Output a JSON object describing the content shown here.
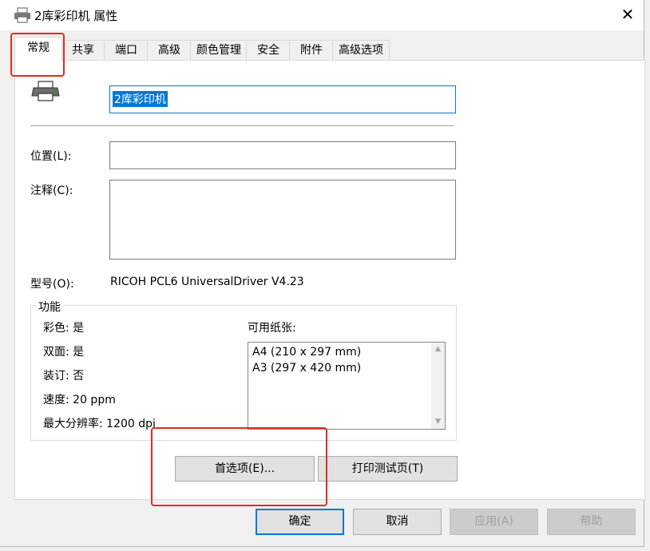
{
  "window": {
    "title": "2库彩印机 属性",
    "close": "✕"
  },
  "tabs": [
    "常规",
    "共享",
    "端口",
    "高级",
    "颜色管理",
    "安全",
    "附件",
    "高级选项"
  ],
  "general": {
    "printer_name": "2库彩印机",
    "location_label": "位置(L):",
    "location_value": "",
    "comment_label": "注释(C):",
    "comment_value": "",
    "model_label": "型号(O):",
    "model_value": "RICOH PCL6 UniversalDriver V4.23"
  },
  "features": {
    "title": "功能",
    "color": "彩色: 是",
    "duplex": "双面: 是",
    "staple": "装订: 否",
    "speed": "速度: 20 ppm",
    "resolution": "最大分辨率: 1200 dpi",
    "paper_label": "可用纸张:",
    "papers": [
      "A4 (210 x 297 mm)",
      "A3 (297 x 420 mm)"
    ]
  },
  "buttons": {
    "preferences": "首选项(E)...",
    "test_page": "打印测试页(T)",
    "ok": "确定",
    "cancel": "取消",
    "apply": "应用(A)",
    "help": "帮助"
  },
  "icons": {
    "title": "printer-icon",
    "printer": "printer-icon"
  },
  "colors": {
    "accent": "#0078d7",
    "highlight": "#e8291c"
  }
}
